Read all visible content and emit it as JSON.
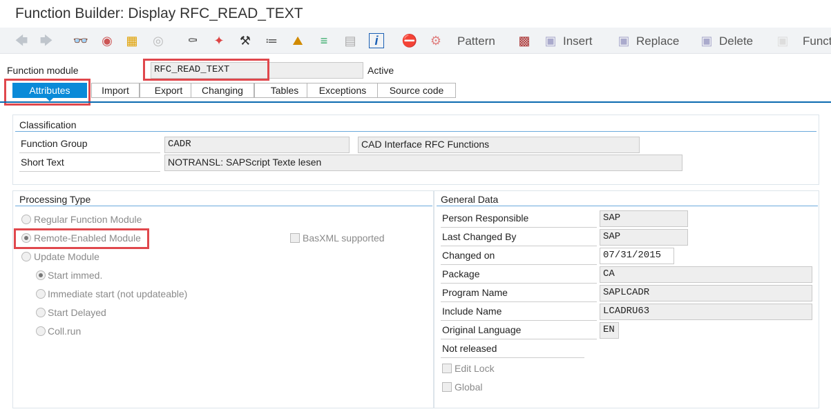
{
  "window": {
    "title": "Function Builder: Display RFC_READ_TEXT"
  },
  "toolbar": {
    "icons": [
      "back-arrow-icon",
      "forward-arrow-icon",
      "glasses-display-change-icon",
      "objects-icon",
      "activate-icon",
      "other-object-icon",
      "where-used-icon",
      "magic-wand-icon",
      "hammer-icon",
      "object-list-icon",
      "hierarchy-icon",
      "navigation-stack-icon",
      "layout-icon",
      "info-icon"
    ],
    "pattern_label": "Pattern",
    "insert_label": "Insert",
    "replace_label": "Replace",
    "delete_label": "Delete",
    "function_label": "Funct"
  },
  "header": {
    "function_module_label": "Function module",
    "function_module_value": "RFC_READ_TEXT",
    "status": "Active"
  },
  "tabs": [
    {
      "label": "Attributes",
      "active": true
    },
    {
      "label": "Import"
    },
    {
      "label": "Export"
    },
    {
      "label": "Changing"
    },
    {
      "label": "Tables"
    },
    {
      "label": "Exceptions"
    },
    {
      "label": "Source code"
    }
  ],
  "classification": {
    "title": "Classification",
    "function_group_label": "Function Group",
    "function_group_value": "CADR",
    "function_group_desc": "CAD Interface RFC Functions",
    "short_text_label": "Short Text",
    "short_text_value": "NOTRANSL: SAPScript Texte lesen"
  },
  "processing_type": {
    "title": "Processing Type",
    "options": [
      "Regular Function Module",
      "Remote-Enabled Module",
      "Update Module"
    ],
    "selected": "Remote-Enabled Module",
    "basxml_label": "BasXML supported",
    "update_options": [
      "Start immed.",
      "Immediate start (not updateable)",
      "Start Delayed",
      "Coll.run"
    ],
    "update_selected": "Start immed."
  },
  "general_data": {
    "title": "General Data",
    "person_responsible_label": "Person Responsible",
    "person_responsible_value": "SAP",
    "last_changed_by_label": "Last Changed By",
    "last_changed_by_value": "SAP",
    "changed_on_label": "Changed on",
    "changed_on_value": "07/31/2015",
    "package_label": "Package",
    "package_value": "CA",
    "program_name_label": "Program Name",
    "program_name_value": "SAPLCADR",
    "include_name_label": "Include Name",
    "include_name_value": "LCADRU63",
    "original_language_label": "Original Language",
    "original_language_value": "EN",
    "release_status": "Not released",
    "edit_lock_label": "Edit Lock",
    "global_label": "Global"
  },
  "colors": {
    "accent": "#0a8ad8",
    "highlight_box": "#e0474c",
    "group_line": "#6aa9dc"
  }
}
